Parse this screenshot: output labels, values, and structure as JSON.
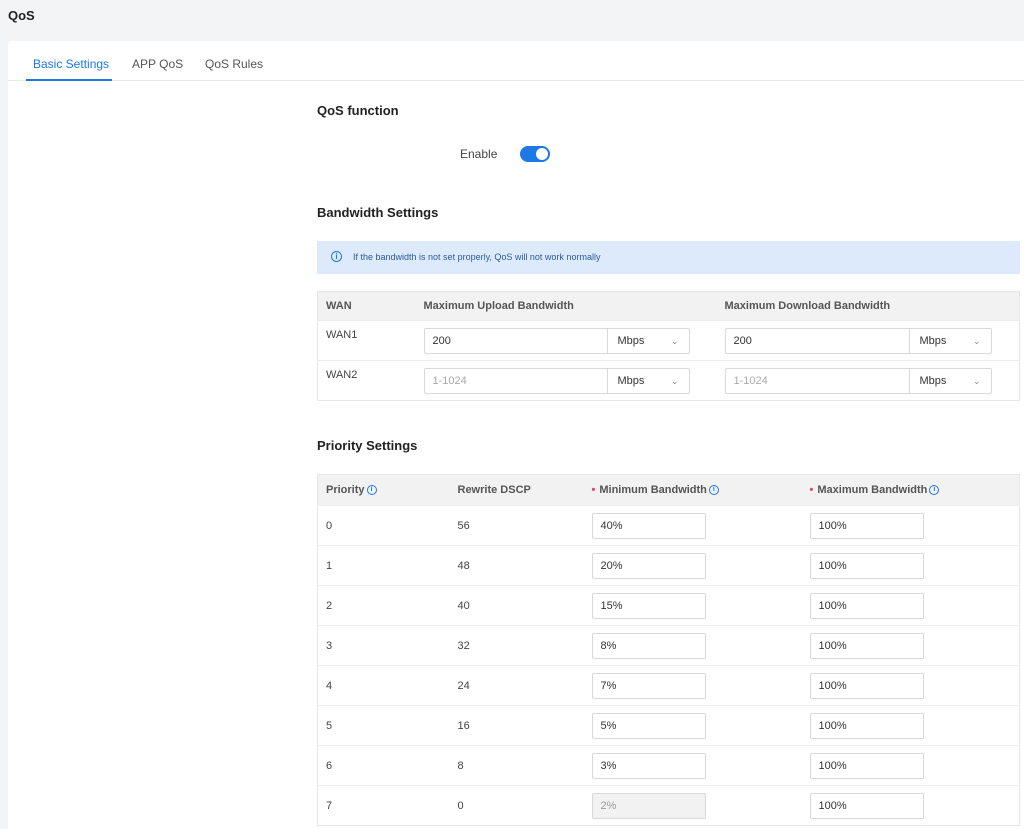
{
  "page": {
    "title": "QoS"
  },
  "tabs": [
    {
      "label": "Basic Settings",
      "active": true
    },
    {
      "label": "APP QoS",
      "active": false
    },
    {
      "label": "QoS Rules",
      "active": false
    }
  ],
  "qos_function": {
    "title": "QoS function",
    "enable_label": "Enable",
    "enabled": true
  },
  "bandwidth": {
    "title": "Bandwidth Settings",
    "alert_icon": "info-icon",
    "alert_text": "If the bandwidth is not set properly, QoS will not work normally",
    "headers": {
      "wan": "WAN",
      "upload": "Maximum Upload Bandwidth",
      "download": "Maximum Download Bandwidth"
    },
    "rows": [
      {
        "wan": "WAN1",
        "upload_value": "200",
        "upload_placeholder": "1-1024",
        "upload_unit": "Mbps",
        "download_value": "200",
        "download_placeholder": "1-1024",
        "download_unit": "Mbps"
      },
      {
        "wan": "WAN2",
        "upload_value": "",
        "upload_placeholder": "1-1024",
        "upload_unit": "Mbps",
        "download_value": "",
        "download_placeholder": "1-1024",
        "download_unit": "Mbps"
      }
    ]
  },
  "priority": {
    "title": "Priority Settings",
    "headers": {
      "priority": "Priority",
      "dscp": "Rewrite DSCP",
      "min": "Minimum Bandwidth",
      "max": "Maximum Bandwidth"
    },
    "rows": [
      {
        "priority": "0",
        "dscp": "56",
        "min": "40%",
        "max": "100%"
      },
      {
        "priority": "1",
        "dscp": "48",
        "min": "20%",
        "max": "100%"
      },
      {
        "priority": "2",
        "dscp": "40",
        "min": "15%",
        "max": "100%"
      },
      {
        "priority": "3",
        "dscp": "32",
        "min": "8%",
        "max": "100%"
      },
      {
        "priority": "4",
        "dscp": "24",
        "min": "7%",
        "max": "100%"
      },
      {
        "priority": "5",
        "dscp": "16",
        "min": "5%",
        "max": "100%"
      },
      {
        "priority": "6",
        "dscp": "8",
        "min": "3%",
        "max": "100%"
      },
      {
        "priority": "7",
        "dscp": "0",
        "min": "2%",
        "max": "100%",
        "min_disabled": true
      }
    ]
  },
  "colors": {
    "accent": "#1e78e6",
    "alert_bg": "#dceafb",
    "required": "#e5484d"
  }
}
